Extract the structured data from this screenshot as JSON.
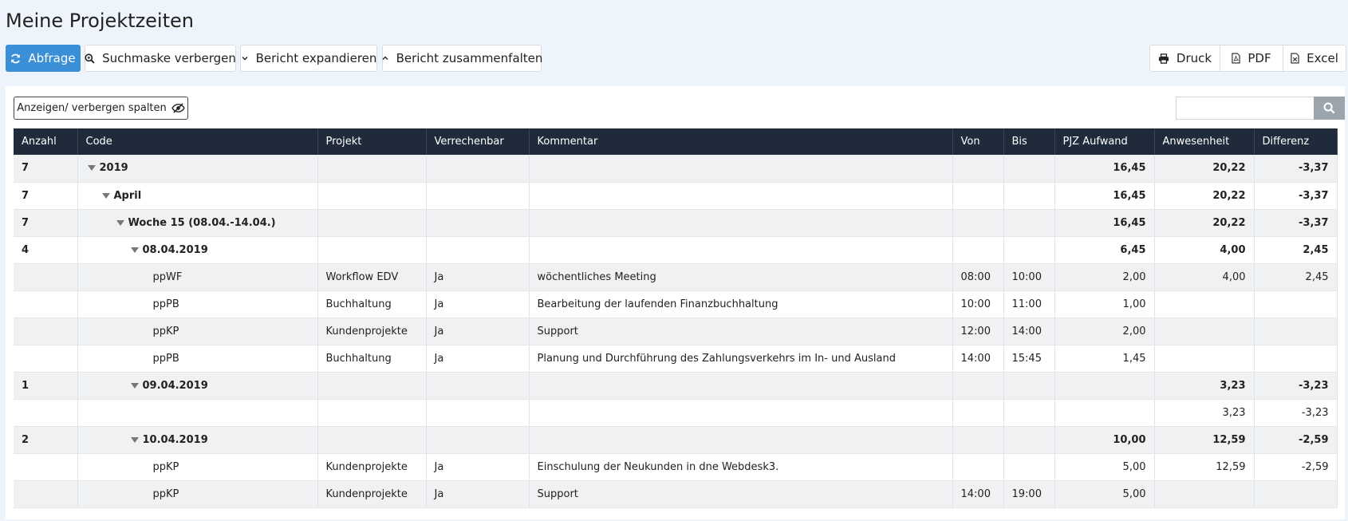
{
  "page": {
    "title": "Meine Projektzeiten"
  },
  "toolbar": {
    "query_label": "Abfrage",
    "hide_search_label": "Suchmaske verbergen",
    "expand_label": "Bericht expandieren",
    "collapse_label": "Bericht zusammenfalten",
    "print_label": "Druck",
    "pdf_label": "PDF",
    "excel_label": "Excel"
  },
  "panel": {
    "toggle_columns_label": "Anzeigen/ verbergen spalten",
    "search_placeholder": ""
  },
  "table": {
    "headers": {
      "count": "Anzahl",
      "code": "Code",
      "project": "Projekt",
      "billable": "Verrechenbar",
      "comment": "Kommentar",
      "from": "Von",
      "to": "Bis",
      "effort": "PJZ Aufwand",
      "presence": "Anwesenheit",
      "difference": "Differenz"
    },
    "rows": [
      {
        "count": "7",
        "code": "2019",
        "project": "",
        "billable": "",
        "comment": "",
        "from": "",
        "to": "",
        "effort": "16,45",
        "presence": "20,22",
        "difference": "-3,37"
      },
      {
        "count": "7",
        "code": "April",
        "project": "",
        "billable": "",
        "comment": "",
        "from": "",
        "to": "",
        "effort": "16,45",
        "presence": "20,22",
        "difference": "-3,37"
      },
      {
        "count": "7",
        "code": "Woche 15 (08.04.-14.04.)",
        "project": "",
        "billable": "",
        "comment": "",
        "from": "",
        "to": "",
        "effort": "16,45",
        "presence": "20,22",
        "difference": "-3,37"
      },
      {
        "count": "4",
        "code": "08.04.2019",
        "project": "",
        "billable": "",
        "comment": "",
        "from": "",
        "to": "",
        "effort": "6,45",
        "presence": "4,00",
        "difference": "2,45"
      },
      {
        "count": "",
        "code": "ppWF",
        "project": "Workflow EDV",
        "billable": "Ja",
        "comment": "wöchentliches Meeting",
        "from": "08:00",
        "to": "10:00",
        "effort": "2,00",
        "presence": "4,00",
        "difference": "2,45"
      },
      {
        "count": "",
        "code": "ppPB",
        "project": "Buchhaltung",
        "billable": "Ja",
        "comment": "Bearbeitung der laufenden Finanzbuchhaltung",
        "from": "10:00",
        "to": "11:00",
        "effort": "1,00",
        "presence": "",
        "difference": ""
      },
      {
        "count": "",
        "code": "ppKP",
        "project": "Kundenprojekte",
        "billable": "Ja",
        "comment": "Support",
        "from": "12:00",
        "to": "14:00",
        "effort": "2,00",
        "presence": "",
        "difference": ""
      },
      {
        "count": "",
        "code": "ppPB",
        "project": "Buchhaltung",
        "billable": "Ja",
        "comment": "Planung und Durchführung des Zahlungsverkehrs im In- und Ausland",
        "from": "14:00",
        "to": "15:45",
        "effort": "1,45",
        "presence": "",
        "difference": ""
      },
      {
        "count": "1",
        "code": "09.04.2019",
        "project": "",
        "billable": "",
        "comment": "",
        "from": "",
        "to": "",
        "effort": "",
        "presence": "3,23",
        "difference": "-3,23"
      },
      {
        "count": "",
        "code": "",
        "project": "",
        "billable": "",
        "comment": "",
        "from": "",
        "to": "",
        "effort": "",
        "presence": "3,23",
        "difference": "-3,23"
      },
      {
        "count": "2",
        "code": "10.04.2019",
        "project": "",
        "billable": "",
        "comment": "",
        "from": "",
        "to": "",
        "effort": "10,00",
        "presence": "12,59",
        "difference": "-2,59"
      },
      {
        "count": "",
        "code": "ppKP",
        "project": "Kundenprojekte",
        "billable": "Ja",
        "comment": "Einschulung der Neukunden in dne Webdesk3.",
        "from": "",
        "to": "",
        "effort": "5,00",
        "presence": "12,59",
        "difference": "-2,59"
      },
      {
        "count": "",
        "code": "ppKP",
        "project": "Kundenprojekte",
        "billable": "Ja",
        "comment": "Support",
        "from": "14:00",
        "to": "19:00",
        "effort": "5,00",
        "presence": "",
        "difference": ""
      }
    ]
  },
  "colors": {
    "primary": "#3a8fd6",
    "header_bg": "#1f2b3a",
    "negative": "#e00000",
    "positive": "#2a24d6"
  }
}
